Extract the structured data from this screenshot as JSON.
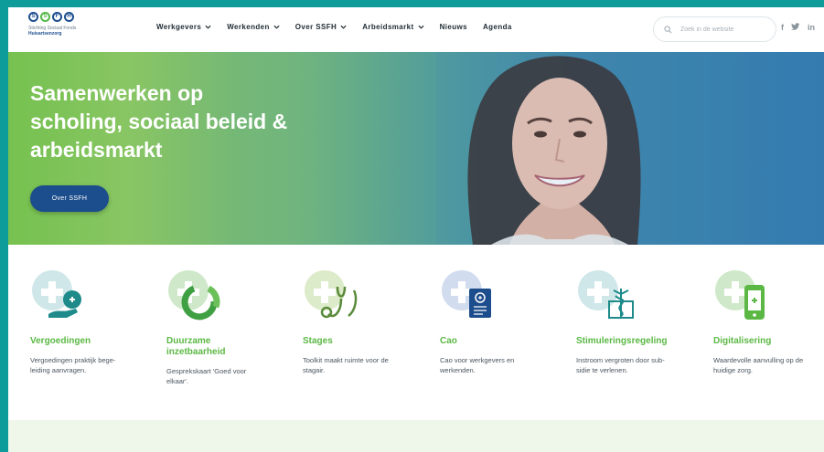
{
  "logo": {
    "letters": [
      "S",
      "S",
      "F",
      "H"
    ],
    "line1": "Stichting Sociaal Fonds",
    "line2": "Huisartsenzorg"
  },
  "nav": {
    "items": [
      {
        "label": "Werkgevers",
        "dropdown": true
      },
      {
        "label": "Werkenden",
        "dropdown": true
      },
      {
        "label": "Over SSFH",
        "dropdown": true
      },
      {
        "label": "Arbeidsmarkt",
        "dropdown": true
      },
      {
        "label": "Nieuws",
        "dropdown": false
      },
      {
        "label": "Agenda",
        "dropdown": false
      }
    ]
  },
  "search": {
    "placeholder": "Zoek in de website"
  },
  "social": {
    "facebook": "f",
    "twitter": "t",
    "linkedin": "in"
  },
  "hero": {
    "title": "Samenwerken op\nscholing, sociaal beleid &\narbeidsmarkt",
    "button": "Over SSFH"
  },
  "cards": [
    {
      "title": "Vergoedingen",
      "desc": "Vergoedingen praktijk bege-\nleiding aanvragen.",
      "icon": "hand-plus-icon"
    },
    {
      "title": "Duurzame\ninzetbaarheid",
      "desc": "Gesprekskaart 'Goed voor\nelkaar'.",
      "icon": "cycle-icon"
    },
    {
      "title": "Stages",
      "desc": "Toolkit maakt ruimte voor de\nstagair.",
      "icon": "stethoscope-icon"
    },
    {
      "title": "Cao",
      "desc": "Cao voor werkgevers en\nwerkenden.",
      "icon": "document-icon"
    },
    {
      "title": "Stimuleringsregeling",
      "desc": "Instroom vergroten door sub-\nsidie te verlenen.",
      "icon": "caduceus-icon"
    },
    {
      "title": "Digitalisering",
      "desc": "Waardevolle aanvulling op de\nhuidige zorg.",
      "icon": "phone-plus-icon"
    }
  ],
  "colors": {
    "teal": "#0e9c9a",
    "brand_blue": "#1c4d8c",
    "brand_green": "#5bb844"
  }
}
